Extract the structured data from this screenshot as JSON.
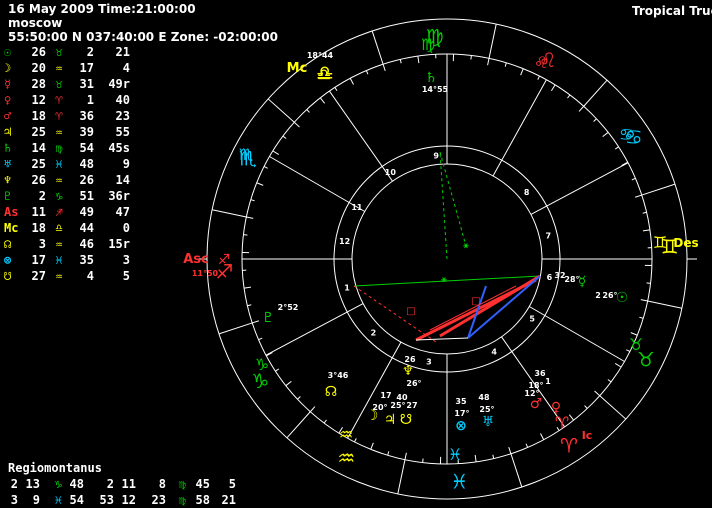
{
  "header": {
    "date_time": "16 May 2009 Time:21:00:00",
    "place": "moscow",
    "coords": "55:50:00 N 037:40:00 E Zone: -02:00:00",
    "mode": "Tropical True"
  },
  "planets": [
    {
      "glyph": "☉",
      "color": "#00d000",
      "deg": "26",
      "sign": "♉",
      "signColor": "#00d000",
      "min": "2",
      "sec": "21"
    },
    {
      "glyph": "☽",
      "color": "#ffff00",
      "deg": "20",
      "sign": "♒",
      "signColor": "#ffff00",
      "min": "17",
      "sec": "4"
    },
    {
      "glyph": "☿",
      "color": "#ff3030",
      "deg": "28",
      "sign": "♉",
      "signColor": "#00d000",
      "min": "31",
      "sec": "49r"
    },
    {
      "glyph": "♀",
      "color": "#ff3030",
      "deg": "12",
      "sign": "♈",
      "signColor": "#ff3030",
      "min": "1",
      "sec": "40"
    },
    {
      "glyph": "♂",
      "color": "#ff3030",
      "deg": "18",
      "sign": "♈",
      "signColor": "#ff3030",
      "min": "36",
      "sec": "23"
    },
    {
      "glyph": "♃",
      "color": "#ffff00",
      "deg": "25",
      "sign": "♒",
      "signColor": "#ffff00",
      "min": "39",
      "sec": "55"
    },
    {
      "glyph": "♄",
      "color": "#00d000",
      "deg": "14",
      "sign": "♍",
      "signColor": "#00d000",
      "min": "54",
      "sec": "45s"
    },
    {
      "glyph": "♅",
      "color": "#00ccff",
      "deg": "25",
      "sign": "♓",
      "signColor": "#00ccff",
      "min": "48",
      "sec": "9"
    },
    {
      "glyph": "♆",
      "color": "#ffff00",
      "deg": "26",
      "sign": "♒",
      "signColor": "#ffff00",
      "min": "26",
      "sec": "14"
    },
    {
      "glyph": "♇",
      "color": "#00d000",
      "deg": "2",
      "sign": "♑",
      "signColor": "#00d000",
      "min": "51",
      "sec": "36r"
    },
    {
      "glyph": "As",
      "color": "#ff3030",
      "deg": "11",
      "sign": "♐",
      "signColor": "#ff3030",
      "min": "49",
      "sec": "47"
    },
    {
      "glyph": "Mc",
      "color": "#ffff00",
      "deg": "18",
      "sign": "♎",
      "signColor": "#ffff00",
      "min": "44",
      "sec": "0"
    },
    {
      "glyph": "☊",
      "color": "#ffff00",
      "deg": "3",
      "sign": "♒",
      "signColor": "#ffff00",
      "min": "46",
      "sec": "15r"
    },
    {
      "glyph": "⊗",
      "color": "#00ccff",
      "deg": "17",
      "sign": "♓",
      "signColor": "#00ccff",
      "min": "35",
      "sec": "3"
    },
    {
      "glyph": "☋",
      "color": "#ffff00",
      "deg": "27",
      "sign": "♒",
      "signColor": "#ffff00",
      "min": "4",
      "sec": "5"
    }
  ],
  "houses": {
    "title": "Regiomontanus",
    "rows": [
      [
        {
          "n": "2",
          "deg": "13",
          "sign": "♑",
          "min": "48"
        },
        {
          "n": "2",
          "deg": "11",
          "sign": "",
          "min": ""
        },
        {
          "n": "8",
          "deg": "",
          "sign": "♍",
          "min": "45"
        },
        {
          "n": "5",
          "deg": "",
          "sign": "",
          "min": ""
        }
      ],
      [
        {
          "n": "3",
          "deg": "9",
          "sign": "♓",
          "min": "54"
        },
        {
          "n": "53",
          "deg": "12",
          "sign": "",
          "min": ""
        },
        {
          "n": "23",
          "deg": "",
          "sign": "♍",
          "min": "58"
        },
        {
          "n": "21",
          "deg": "",
          "sign": "",
          "min": ""
        }
      ]
    ],
    "line1": [
      "2",
      "13",
      "♑",
      "48",
      "2",
      "11",
      "8",
      "♍",
      "45",
      "5"
    ],
    "line2": [
      "3",
      "9",
      "♓",
      "54",
      "53",
      "12",
      "23",
      "♍",
      "58",
      "21"
    ]
  },
  "wheel": {
    "zodiac": [
      {
        "glyph": "♍",
        "color": "#00d000"
      },
      {
        "glyph": "♌",
        "color": "#ff3030"
      },
      {
        "glyph": "♋",
        "color": "#00ccff"
      },
      {
        "glyph": "♊",
        "color": "#ffff00"
      },
      {
        "glyph": "♉",
        "color": "#00d000"
      },
      {
        "glyph": "♈",
        "color": "#ff3030"
      },
      {
        "glyph": "♓",
        "color": "#00ccff"
      },
      {
        "glyph": "♒",
        "color": "#ffff00"
      },
      {
        "glyph": "♑",
        "color": "#00d000"
      },
      {
        "glyph": "♐",
        "color": "#ff3030"
      },
      {
        "glyph": "♏",
        "color": "#00ccff"
      },
      {
        "glyph": "♎",
        "color": "#ffff00"
      }
    ],
    "angles": {
      "mc": "Mc",
      "asc": "Asc",
      "des": "Des",
      "ic": "Ic"
    },
    "house_numbers": [
      "9",
      "10",
      "11",
      "12",
      "1",
      "2",
      "3",
      "4",
      "5",
      "6",
      "7",
      "8"
    ],
    "labels": {
      "mc_deg": "18°44",
      "asc_deg": "11°50",
      "sat": "14°55",
      "pluto": "2°52",
      "node": "3°46",
      "moon": "20°",
      "jup": "25°",
      "nep": "26°",
      "moon_min": "17",
      "jup_min": "40",
      "nep_min": "27",
      "part": "17°",
      "uran": "25°",
      "part_min": "35",
      "uran_min": "48",
      "mars": "18°",
      "venus": "12°",
      "mars_min": "36",
      "venus_min": "1",
      "merc": "28°",
      "sun": "26°",
      "merc_min": "32",
      "sun_min": "2",
      "h_26": "26",
      "h_26b": "26"
    }
  }
}
